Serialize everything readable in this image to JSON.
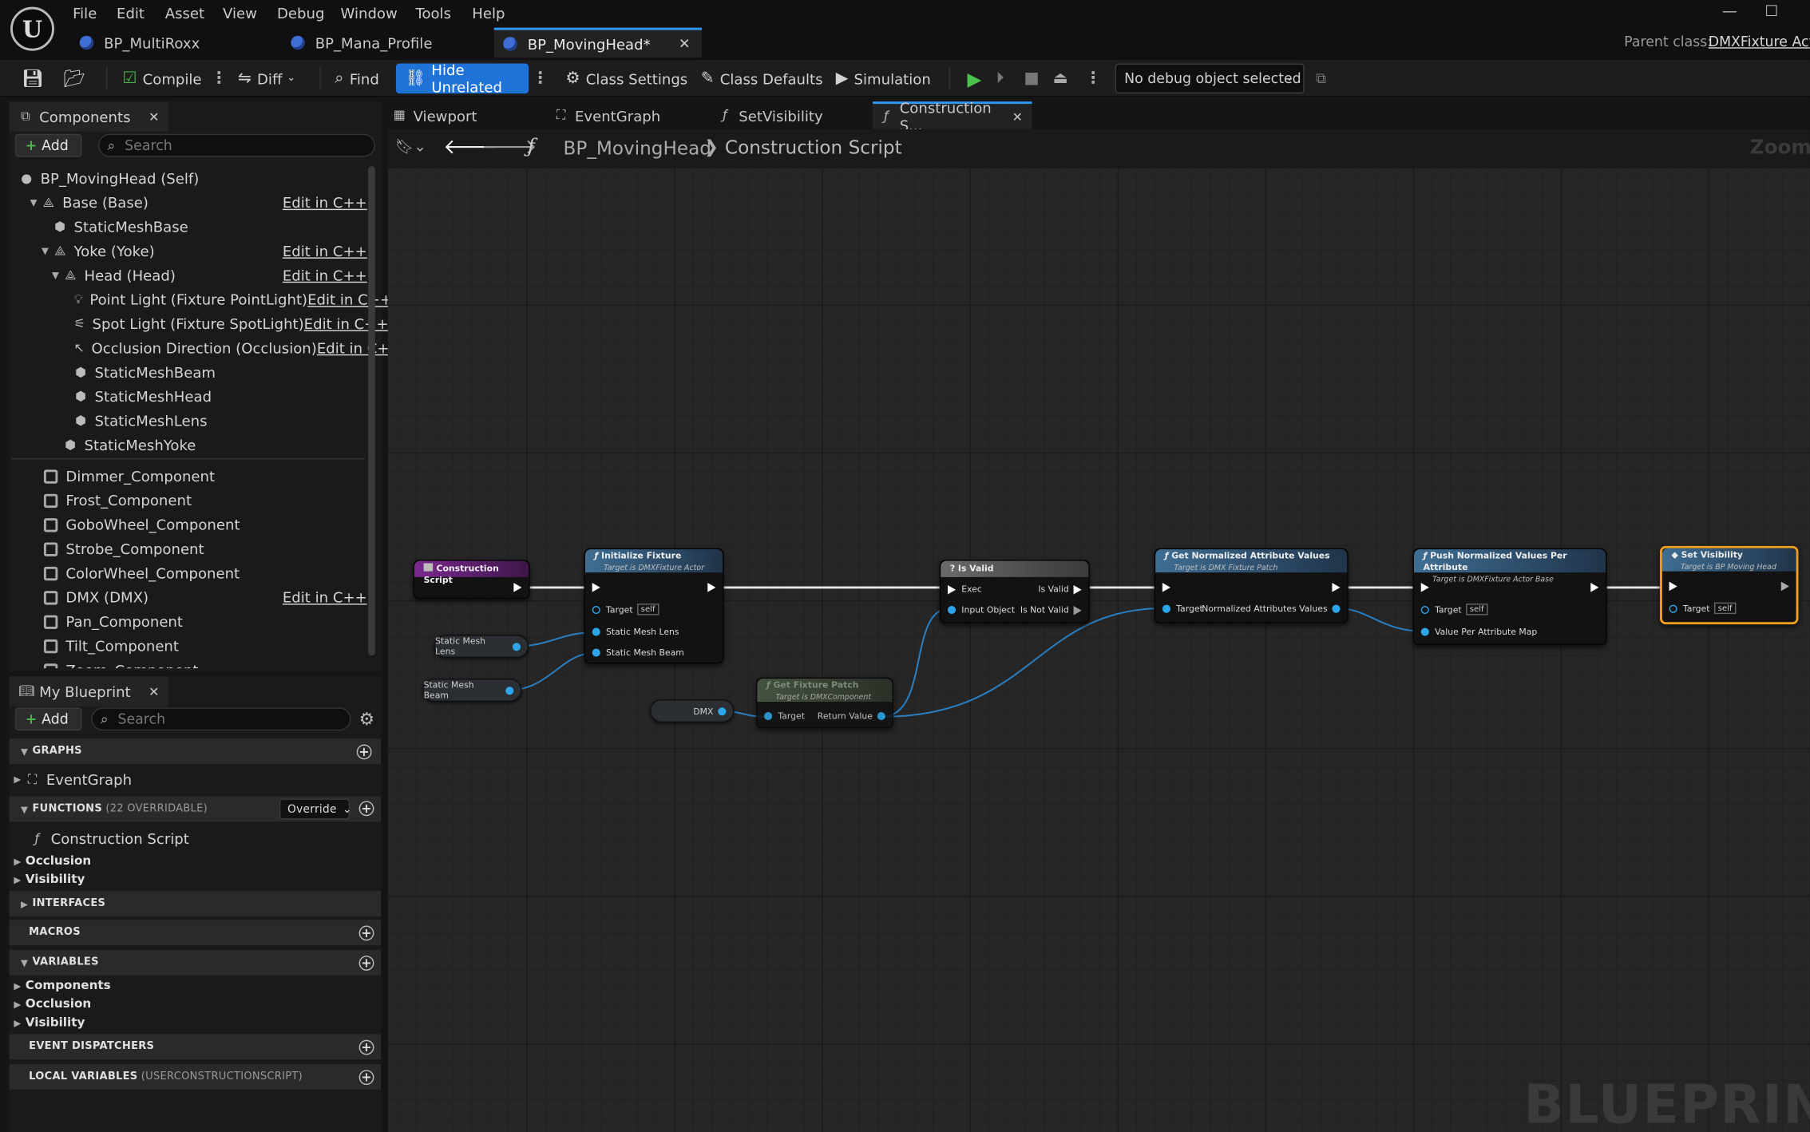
{
  "menu": [
    "File",
    "Edit",
    "Asset",
    "View",
    "Debug",
    "Window",
    "Tools",
    "Help"
  ],
  "tabs": [
    "BP_MultiRoxx",
    "BP_Mana_Profile",
    "BP_MovingHead*"
  ],
  "parent_class_label": "Parent class:",
  "parent_class_value": "DMXFixture Acto",
  "toolbar": {
    "compile": "Compile",
    "diff": "Diff",
    "find": "Find",
    "hide_unrelated": "Hide Unrelated",
    "class_settings": "Class Settings",
    "class_defaults": "Class Defaults",
    "simulation": "Simulation",
    "debug_object": "No debug object selected"
  },
  "components": {
    "title": "Components",
    "add": "Add",
    "search_placeholder": "Search",
    "edit_cpp": "Edit in C++",
    "tree": [
      "BP_MovingHead (Self)",
      "Base (Base)",
      "StaticMeshBase",
      "Yoke (Yoke)",
      "Head (Head)",
      "Point Light (Fixture PointLight)",
      "Spot Light (Fixture SpotLight)",
      "Occlusion Direction (Occlusion)",
      "StaticMeshBeam",
      "StaticMeshHead",
      "StaticMeshLens",
      "StaticMeshYoke"
    ],
    "list": [
      "Dimmer_Component",
      "Frost_Component",
      "GoboWheel_Component",
      "Strobe_Component",
      "ColorWheel_Component",
      "DMX (DMX)",
      "Pan_Component",
      "Tilt_Component",
      "Zoom_Component"
    ]
  },
  "my_blueprint": {
    "title": "My Blueprint",
    "add": "Add",
    "search_placeholder": "Search",
    "graphs": "GRAPHS",
    "event_graph": "EventGraph",
    "functions": "FUNCTIONS",
    "functions_sub": "(22 OVERRIDABLE)",
    "override": "Override",
    "construction_script": "Construction Script",
    "occlusion": "Occlusion",
    "visibility": "Visibility",
    "interfaces": "INTERFACES",
    "macros": "MACROS",
    "variables": "VARIABLES",
    "var_components": "Components",
    "var_occlusion": "Occlusion",
    "var_visibility": "Visibility",
    "event_dispatchers": "EVENT DISPATCHERS",
    "local_variables": "LOCAL VARIABLES",
    "local_variables_sub": "(USERCONSTRUCTIONSCRIPT)"
  },
  "graph_tabs": [
    "Viewport",
    "EventGraph",
    "SetVisibility",
    "Construction S..."
  ],
  "breadcrumb": {
    "root": "BP_MovingHead",
    "current": "Construction Script"
  },
  "zoom_label": "Zoom -",
  "watermark": "BLUEPRINT",
  "nodes": {
    "construction_script": "Construction Script",
    "initialize_fixture": {
      "title": "Initialize Fixture",
      "sub": "Target is DMXFixture Actor",
      "target": "Target",
      "self": "self",
      "lens": "Static Mesh Lens",
      "beam": "Static Mesh Beam"
    },
    "var_lens": "Static Mesh Lens",
    "var_beam": "Static Mesh Beam",
    "var_dmx": "DMX",
    "get_fixture_patch": {
      "title": "Get Fixture Patch",
      "sub": "Target is DMXComponent",
      "target": "Target",
      "return": "Return Value"
    },
    "is_valid": {
      "title": "? Is Valid",
      "exec": "Exec",
      "is_valid": "Is Valid",
      "input_object": "Input Object",
      "is_not_valid": "Is Not Valid"
    },
    "get_normalized": {
      "title": "Get Normalized Attribute Values",
      "sub": "Target is DMX Fixture Patch",
      "target": "Target",
      "out": "Normalized Attributes Values"
    },
    "push_normalized": {
      "title": "Push Normalized Values Per Attribute",
      "sub": "Target is DMXFixture Actor Base",
      "target": "Target",
      "self": "self",
      "map": "Value Per Attribute Map"
    },
    "set_visibility": {
      "title": "Set Visibility",
      "sub": "Target is BP Moving Head",
      "target": "Target",
      "self": "self"
    }
  }
}
